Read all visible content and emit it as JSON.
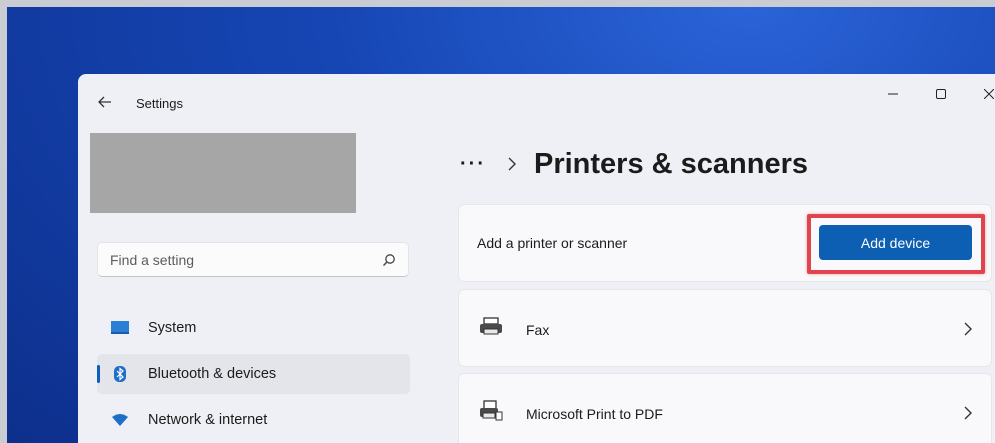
{
  "window": {
    "app_title": "Settings",
    "controls": {
      "minimize": "minimize-icon",
      "maximize": "maximize-icon",
      "close": "close-icon"
    }
  },
  "sidebar": {
    "search": {
      "placeholder": "Find a setting",
      "value": ""
    },
    "items": [
      {
        "label": "System",
        "icon": "system-display-icon",
        "active": false
      },
      {
        "label": "Bluetooth & devices",
        "icon": "bluetooth-icon",
        "active": true
      },
      {
        "label": "Network & internet",
        "icon": "wifi-icon",
        "active": false
      }
    ]
  },
  "main": {
    "breadcrumb_more": "···",
    "page_title": "Printers & scanners",
    "add_card": {
      "label": "Add a printer or scanner",
      "button_label": "Add device",
      "highlighted": true
    },
    "devices": [
      {
        "label": "Fax",
        "icon": "fax-icon"
      },
      {
        "label": "Microsoft Print to PDF",
        "icon": "printer-icon"
      }
    ]
  },
  "colors": {
    "accent": "#0c5fb3",
    "highlight": "#e0444c",
    "window_bg": "#eef0f5",
    "card_bg": "#f9f9fb"
  }
}
